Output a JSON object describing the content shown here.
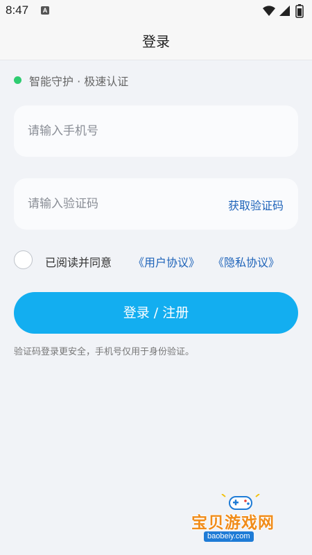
{
  "status_bar": {
    "time": "8:47",
    "notification_icon_letter": "A",
    "icons": [
      "wifi-icon",
      "cellular-signal-icon",
      "battery-icon"
    ]
  },
  "header": {
    "title": "登录"
  },
  "badge": {
    "text": "智能守护 · 极速认证",
    "dot_color": "#2ECC71"
  },
  "form": {
    "phone_placeholder": "请输入手机号",
    "phone_value": "",
    "code_placeholder": "请输入验证码",
    "code_value": "",
    "get_code_label": "获取验证码",
    "agree_checked": false,
    "agree_text": "已阅读并同意",
    "user_agreement_label": "《用户协议》",
    "privacy_policy_label": "《隐私协议》",
    "submit_label": "登录 / 注册",
    "hint": "验证码登录更安全，手机号仅用于身份验证。"
  },
  "watermark": {
    "text": "宝贝游戏网",
    "url": "baobeiy.com"
  },
  "colors": {
    "accent": "#13AEF0",
    "link": "#1E63B9",
    "background": "#F1F3F7"
  }
}
